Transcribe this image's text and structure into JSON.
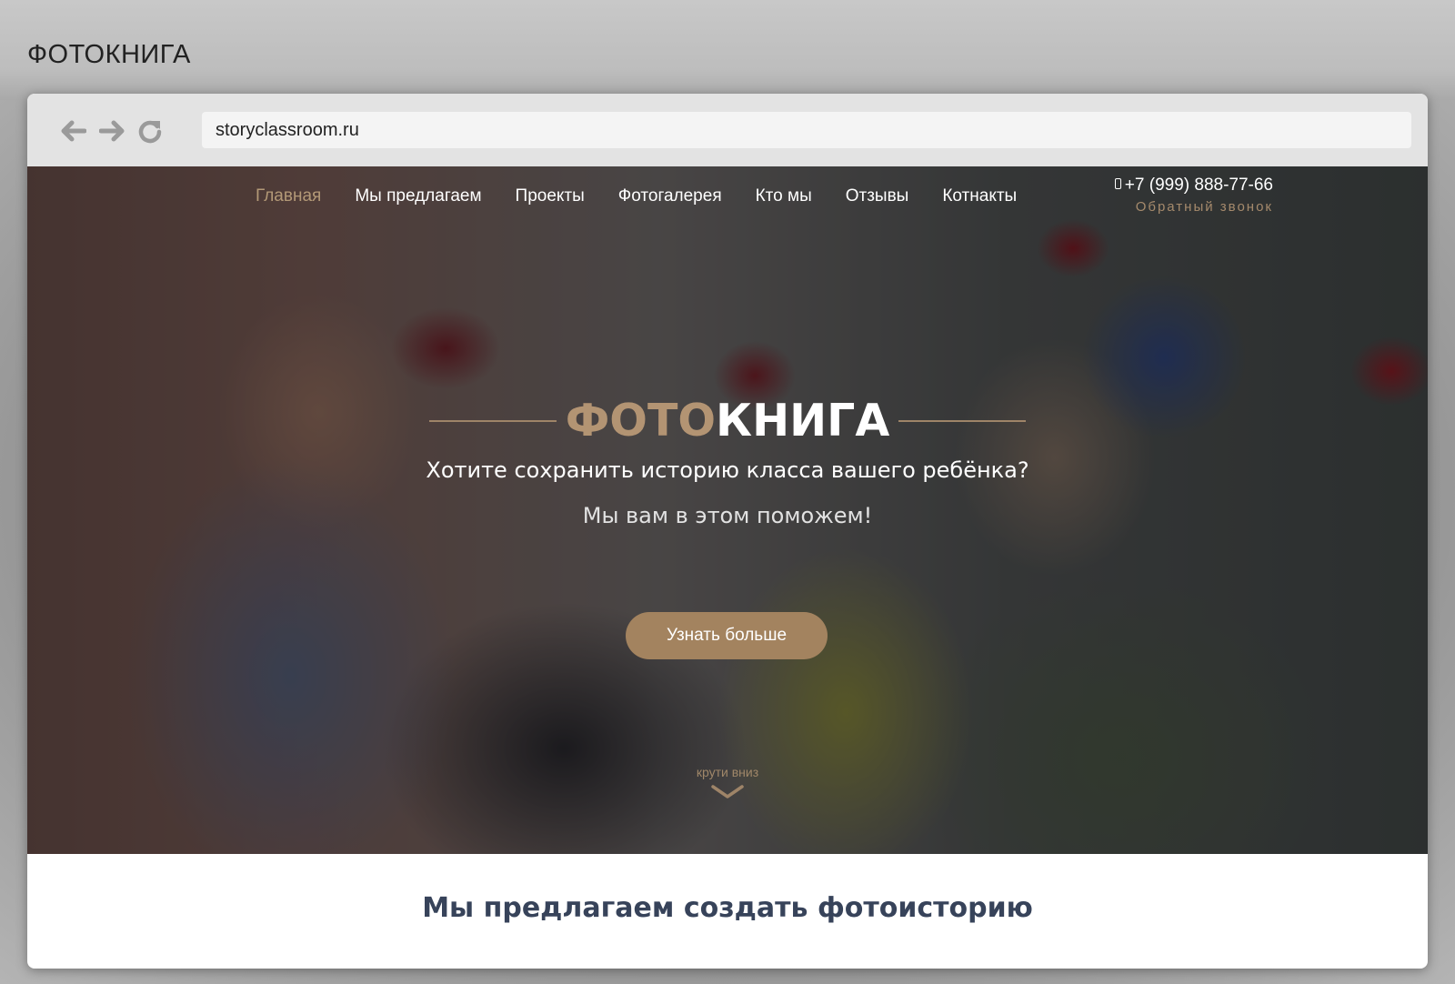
{
  "page": {
    "heading": "ФОТОКНИГА"
  },
  "browser": {
    "url": "storyclassroom.ru",
    "back_icon": "arrow-left-icon",
    "forward_icon": "arrow-right-icon",
    "reload_icon": "reload-icon"
  },
  "site": {
    "nav": {
      "items": [
        {
          "label": "Главная",
          "active": true
        },
        {
          "label": "Мы предлагаем",
          "active": false
        },
        {
          "label": "Проекты",
          "active": false
        },
        {
          "label": "Фотогалерея",
          "active": false
        },
        {
          "label": "Кто мы",
          "active": false
        },
        {
          "label": "Отзывы",
          "active": false
        },
        {
          "label": "Котнакты",
          "active": false
        }
      ]
    },
    "contact": {
      "phone": "+7 (999) 888-77-66",
      "callback": "Обратный звонок"
    },
    "hero": {
      "title_accent": "ФОТО",
      "title_main": "КНИГА",
      "subtitle": "Хотите сохранить историю класса вашего ребёнка?",
      "subtitle2": "Мы вам в этом поможем!",
      "cta_label": "Узнать больше",
      "scroll_hint": "крути вниз"
    },
    "section": {
      "heading": "Мы предлагаем создать фотоисторию"
    }
  },
  "colors": {
    "accent": "#a3835f",
    "nav_active": "#b39977",
    "heading_dark": "#37435a",
    "toolbar": "#e3e3e3"
  }
}
